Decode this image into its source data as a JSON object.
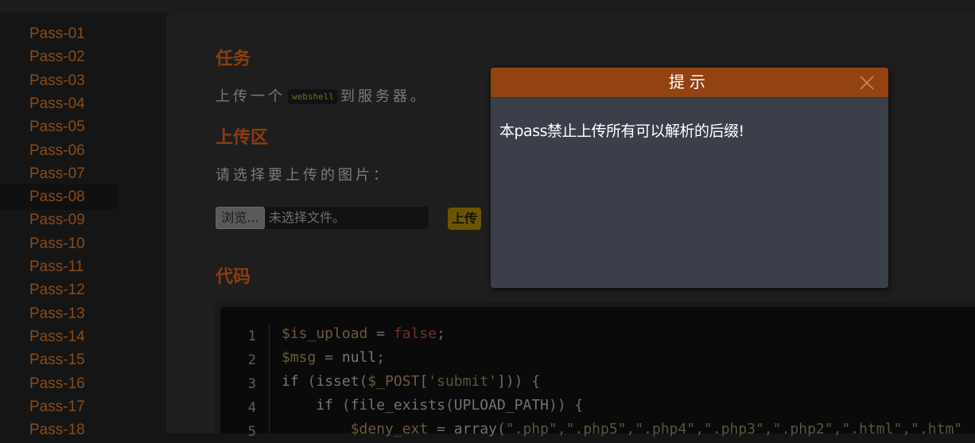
{
  "sidebar": {
    "items": [
      {
        "label": "Pass-01"
      },
      {
        "label": "Pass-02"
      },
      {
        "label": "Pass-03"
      },
      {
        "label": "Pass-04"
      },
      {
        "label": "Pass-05"
      },
      {
        "label": "Pass-06"
      },
      {
        "label": "Pass-07"
      },
      {
        "label": "Pass-08"
      },
      {
        "label": "Pass-09"
      },
      {
        "label": "Pass-10"
      },
      {
        "label": "Pass-11"
      },
      {
        "label": "Pass-12"
      },
      {
        "label": "Pass-13"
      },
      {
        "label": "Pass-14"
      },
      {
        "label": "Pass-15"
      },
      {
        "label": "Pass-16"
      },
      {
        "label": "Pass-17"
      },
      {
        "label": "Pass-18"
      }
    ],
    "active": "Pass-08"
  },
  "main": {
    "task_heading": "任务",
    "task_text_before": "上传一个",
    "task_code": "webshell",
    "task_text_after": "到服务器。",
    "upload_heading": "上传区",
    "upload_prompt": "请选择要上传的图片：",
    "browse_label": "浏览...",
    "file_status": "未选择文件。",
    "upload_button": "上传",
    "code_heading": "代码"
  },
  "code": {
    "line_numbers": [
      "1",
      "2",
      "3",
      "4",
      "5"
    ],
    "lines": [
      {
        "l1": "$is_upload",
        "l2": " = ",
        "l3": "false",
        "l4": ";"
      },
      {
        "l1": "$msg",
        "l2": " = ",
        "l3": "null",
        "l4": ";"
      },
      {
        "l1": "if",
        "l2": " (",
        "l3": "isset",
        "l4": "(",
        "l5": "$_POST",
        "l6": "[",
        "l7": "'submit'",
        "l8": "])) {"
      },
      {
        "l1": "    if",
        "l2": " (",
        "l3": "file_exists",
        "l4": "(",
        "l5": "UPLOAD_PATH",
        "l6": ")) {"
      },
      {
        "l1": "        $deny_ext",
        "l2": " = ",
        "l3": "array",
        "l4": "(",
        "l5": "\".php\",\".php5\",\".php4\",\".php3\",\".php2\",\".html\",\".htm\""
      }
    ]
  },
  "modal": {
    "title": "提示",
    "message": "本pass禁止上传所有可以解析的后缀!"
  }
}
